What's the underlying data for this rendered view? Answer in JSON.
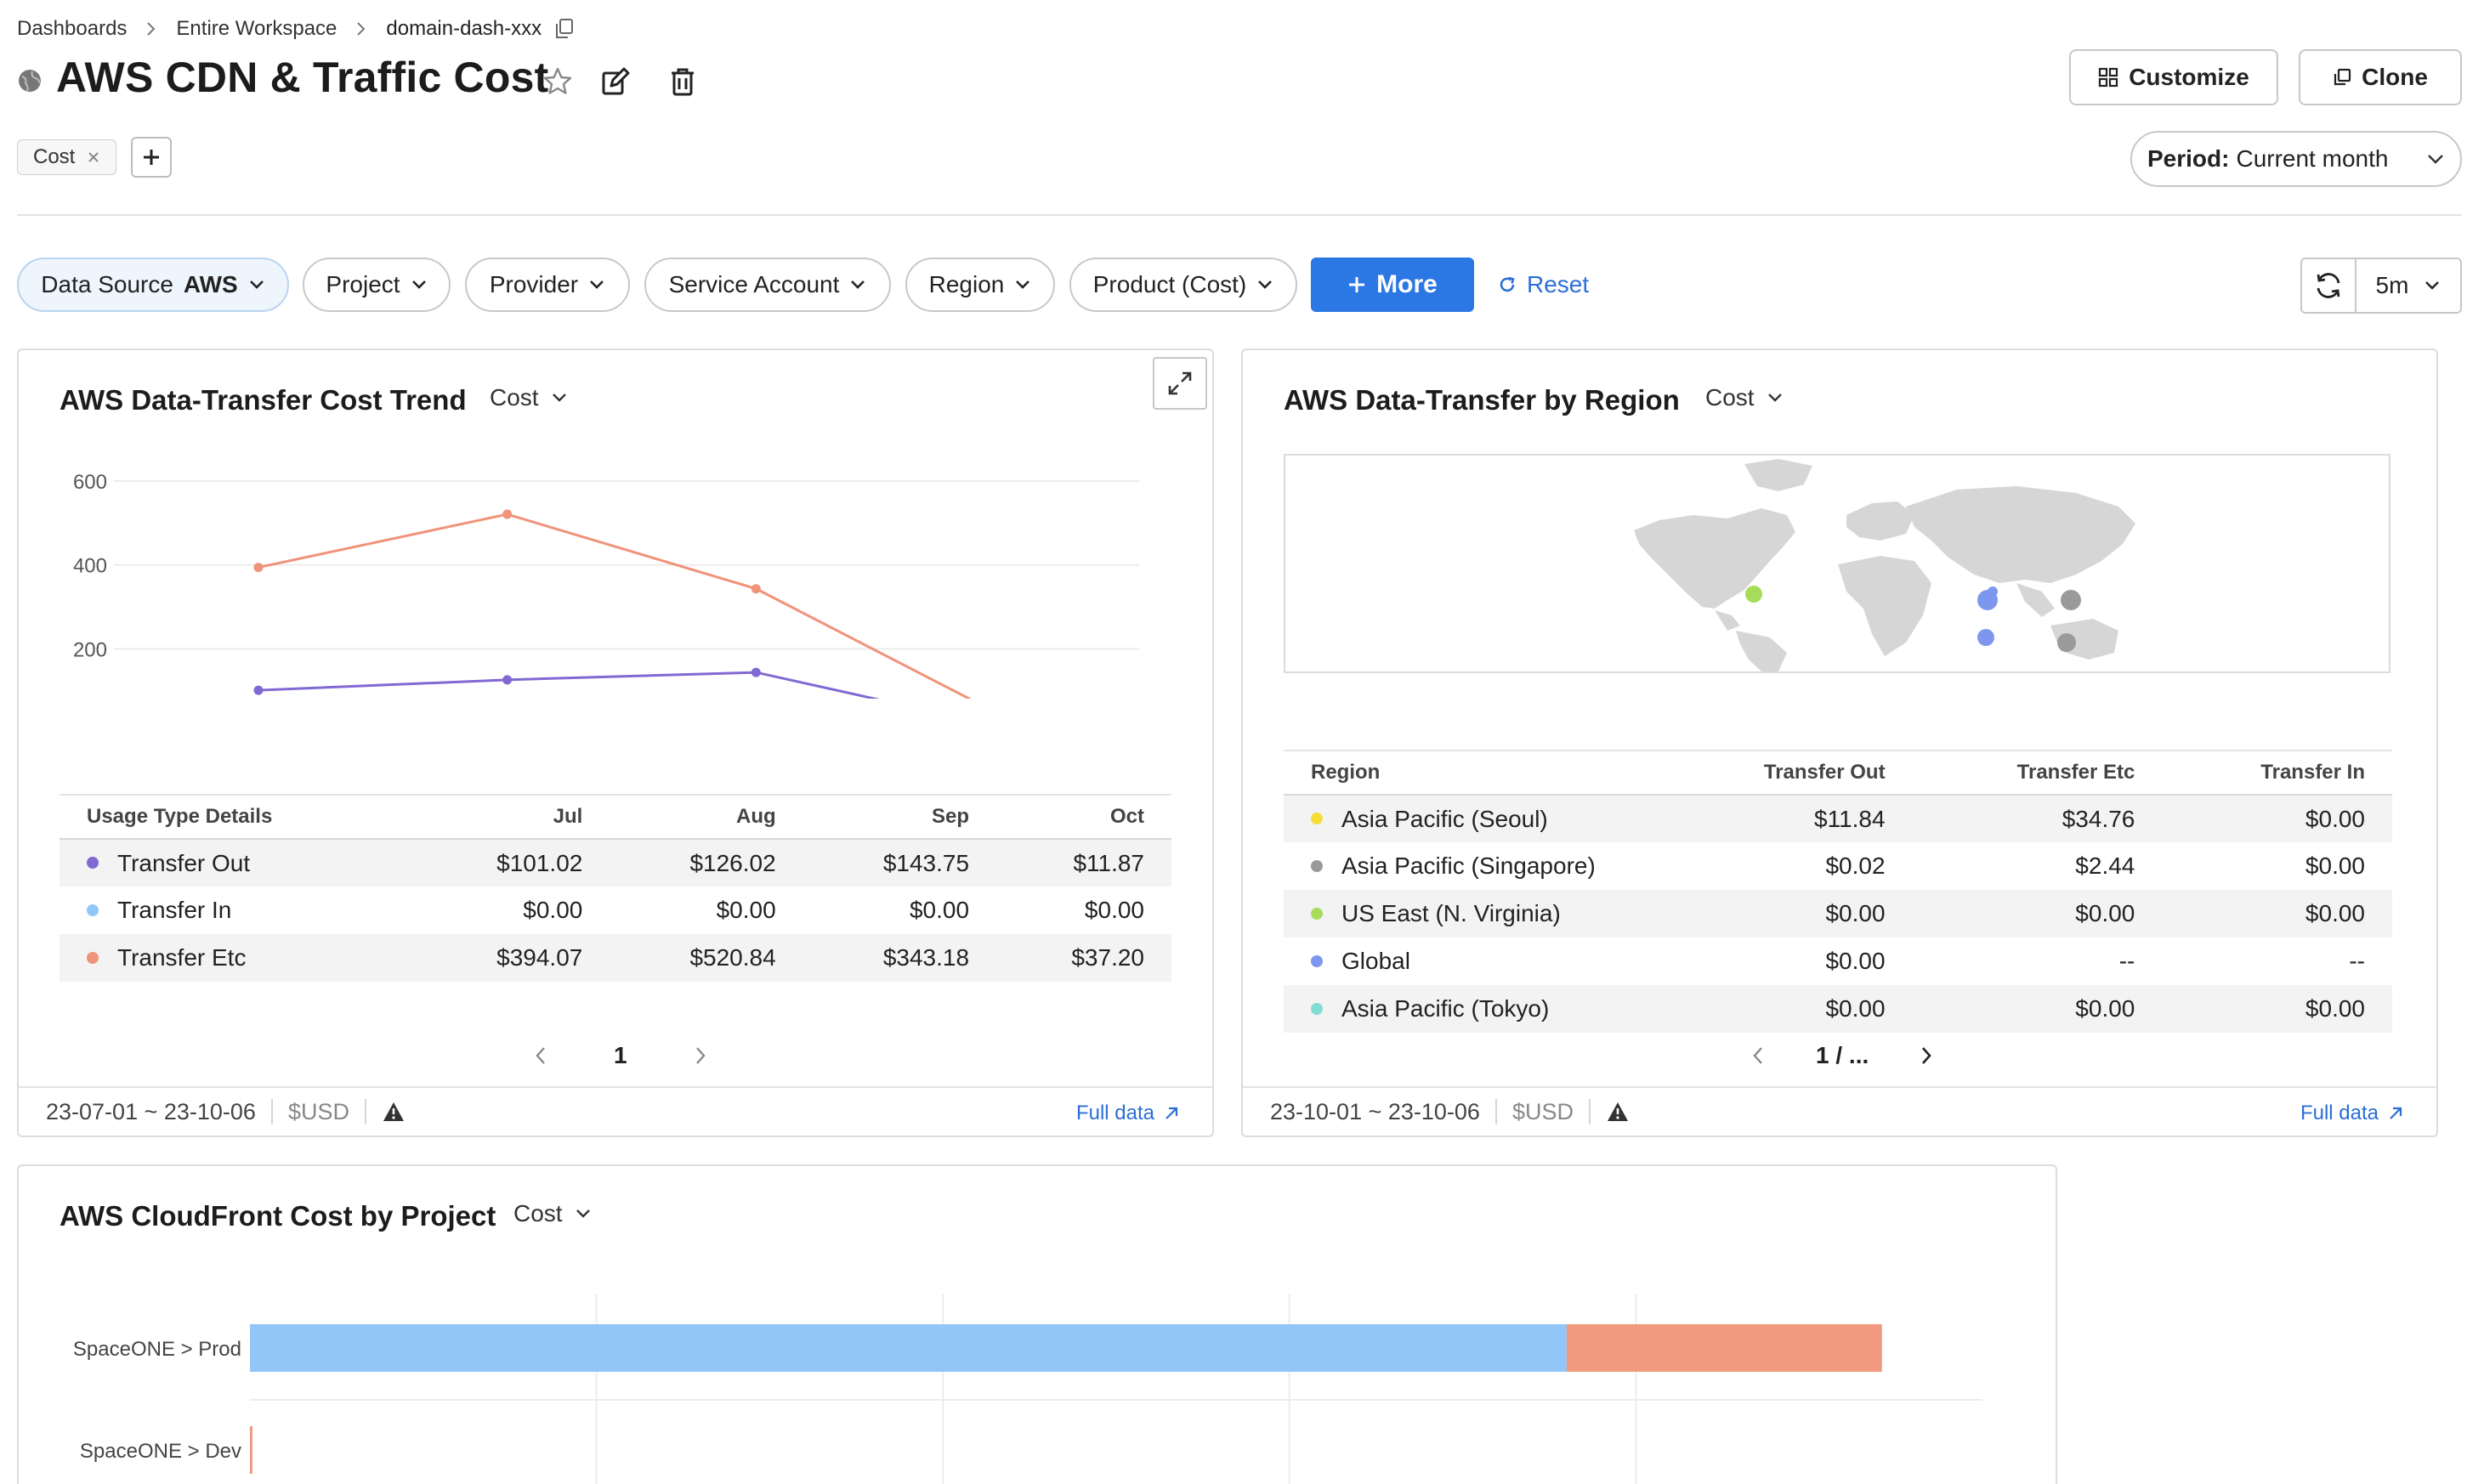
{
  "breadcrumb": {
    "item1": "Dashboards",
    "item2": "Entire Workspace",
    "item3": "domain-dash-xxx"
  },
  "header": {
    "title": "AWS CDN & Traffic Cost",
    "customize_label": "Customize",
    "clone_label": "Clone"
  },
  "labels": {
    "tag": "Cost",
    "period_key": "Period:",
    "period_value": "Current month"
  },
  "filters": {
    "data_source_key": "Data Source",
    "data_source_value": "AWS",
    "project": "Project",
    "provider": "Provider",
    "service_account": "Service Account",
    "region": "Region",
    "product": "Product (Cost)",
    "more": "More",
    "reset": "Reset",
    "refresh_interval": "5m"
  },
  "trend_widget": {
    "title": "AWS Data-Transfer Cost Trend",
    "unit": "Cost",
    "table_header": {
      "name": "Usage Type Details",
      "c1": "Jul",
      "c2": "Aug",
      "c3": "Sep",
      "c4": "Oct"
    },
    "rows": [
      {
        "name": "Transfer Out",
        "color": "#8169d3",
        "c1": "$101.02",
        "c2": "$126.02",
        "c3": "$143.75",
        "c4": "$11.87"
      },
      {
        "name": "Transfer In",
        "color": "#92c5f8",
        "c1": "$0.00",
        "c2": "$0.00",
        "c3": "$0.00",
        "c4": "$0.00"
      },
      {
        "name": "Transfer Etc",
        "color": "#f0937a",
        "c1": "$394.07",
        "c2": "$520.84",
        "c3": "$343.18",
        "c4": "$37.20"
      }
    ],
    "page": "1",
    "date_range": "23-07-01 ~ 23-10-06",
    "currency": "$USD",
    "full_data": "Full data"
  },
  "region_widget": {
    "title": "AWS Data-Transfer by Region",
    "unit": "Cost",
    "table_header": {
      "name": "Region",
      "c1": "Transfer Out",
      "c2": "Transfer Etc",
      "c3": "Transfer In"
    },
    "rows": [
      {
        "name": "Asia Pacific (Seoul)",
        "color": "#f5dd38",
        "c1": "$11.84",
        "c2": "$34.76",
        "c3": "$0.00"
      },
      {
        "name": "Asia Pacific (Singapore)",
        "color": "#9a9a9a",
        "c1": "$0.02",
        "c2": "$2.44",
        "c3": "$0.00"
      },
      {
        "name": "US East (N. Virginia)",
        "color": "#a7dc5a",
        "c1": "$0.00",
        "c2": "$0.00",
        "c3": "$0.00"
      },
      {
        "name": "Global",
        "color": "#7d97ee",
        "c1": "$0.00",
        "c2": "--",
        "c3": "--"
      },
      {
        "name": "Asia Pacific (Tokyo)",
        "color": "#82dcd4",
        "c1": "$0.00",
        "c2": "$0.00",
        "c3": "$0.00"
      }
    ],
    "page": "1 / ...",
    "date_range": "23-10-01 ~ 23-10-06",
    "currency": "$USD",
    "full_data": "Full data"
  },
  "project_widget": {
    "title": "AWS CloudFront Cost by Project",
    "unit": "Cost"
  },
  "chart_data": [
    {
      "type": "line",
      "title": "AWS Data-Transfer Cost Trend",
      "x": [
        "Jul",
        "Aug",
        "Sep",
        "Oct"
      ],
      "ylim": [
        0,
        600
      ],
      "yticks": [
        0,
        200,
        400,
        600
      ],
      "grid": true,
      "series": [
        {
          "name": "Transfer Out",
          "color": "#8169d3",
          "values": [
            101.02,
            126.02,
            143.75,
            11.87
          ]
        },
        {
          "name": "Transfer In",
          "color": "#92c5f8",
          "values": [
            0,
            0,
            0,
            0
          ]
        },
        {
          "name": "Transfer Etc",
          "color": "#f0937a",
          "values": [
            394.07,
            520.84,
            343.18,
            37.2
          ]
        }
      ]
    },
    {
      "type": "bar",
      "orientation": "horizontal",
      "stacked": true,
      "title": "AWS CloudFront Cost by Project",
      "categories": [
        "SpaceONE > Prod",
        "SpaceONE > Dev"
      ],
      "grid": true,
      "series": [
        {
          "color": "#92c5f8",
          "values": [
            3.8,
            0
          ]
        },
        {
          "color": "#f09b80",
          "values": [
            0.91,
            0.005
          ]
        }
      ],
      "xlim": [
        0,
        5
      ]
    }
  ]
}
